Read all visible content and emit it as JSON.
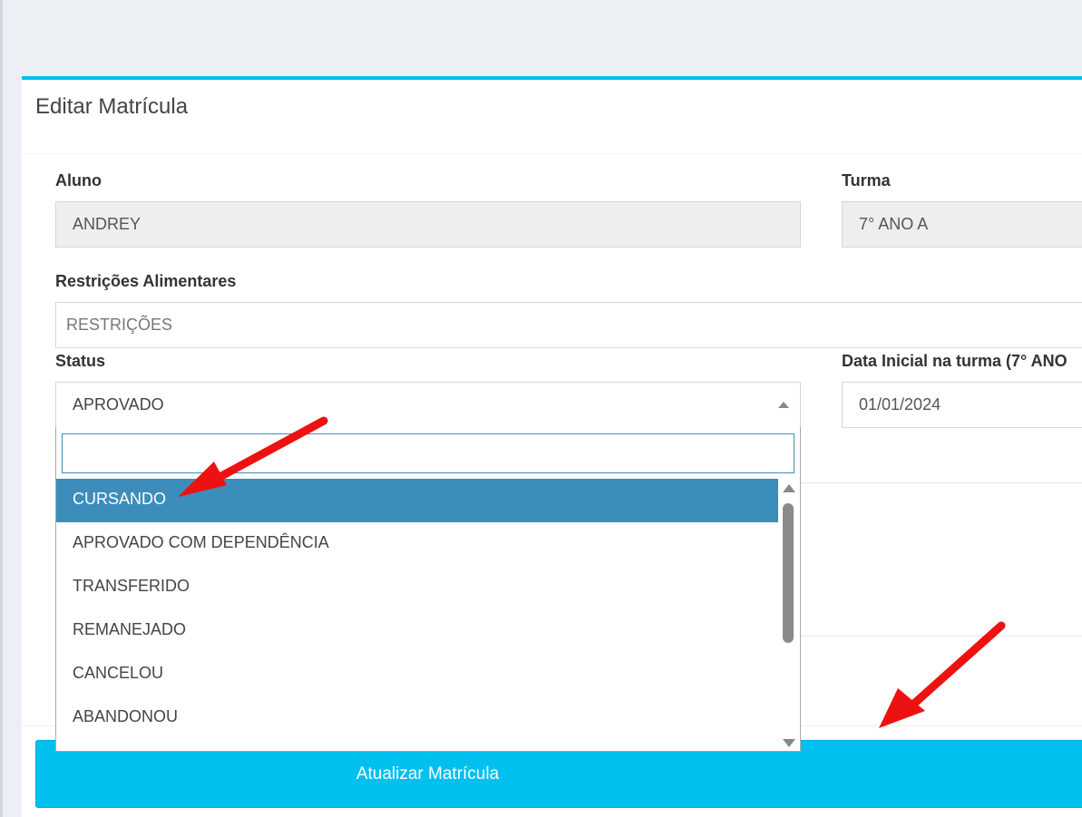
{
  "form": {
    "title": "Editar Matrícula",
    "aluno": {
      "label": "Aluno",
      "value": "ANDREY"
    },
    "turma": {
      "label": "Turma",
      "value": "7° ANO A"
    },
    "restricoes": {
      "label": "Restrições Alimentares",
      "placeholder": "RESTRIÇÕES"
    },
    "status": {
      "label": "Status",
      "selected": "APROVADO"
    },
    "data_inicial": {
      "label": "Data Inicial na turma (7° ANO",
      "value": "01/01/2024"
    },
    "submit_label": "Atualizar Matrícula"
  },
  "status_dropdown": {
    "search_value": "",
    "options": [
      {
        "label": "CURSANDO",
        "highlighted": true
      },
      {
        "label": "APROVADO COM DEPENDÊNCIA",
        "highlighted": false
      },
      {
        "label": "TRANSFERIDO",
        "highlighted": false
      },
      {
        "label": "REMANEJADO",
        "highlighted": false
      },
      {
        "label": "CANCELOU",
        "highlighted": false
      },
      {
        "label": "ABANDONOU",
        "highlighted": false
      }
    ]
  },
  "annotations": {
    "arrow_color": "#ee1111"
  },
  "colors": {
    "accent": "#00c0ef",
    "highlight": "#3c8dbc"
  }
}
